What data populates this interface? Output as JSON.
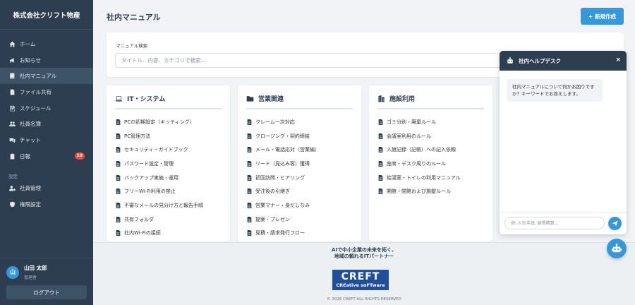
{
  "sidebar": {
    "brand": "株式会社クリフト物産",
    "items": [
      {
        "label": "ホーム",
        "icon": "home-icon"
      },
      {
        "label": "お知らせ",
        "icon": "megaphone-icon"
      },
      {
        "label": "社内マニュアル",
        "icon": "book-icon",
        "active": true
      },
      {
        "label": "ファイル共有",
        "icon": "file-icon"
      },
      {
        "label": "スケジュール",
        "icon": "calendar-icon"
      },
      {
        "label": "社員名簿",
        "icon": "users-icon"
      },
      {
        "label": "チャット",
        "icon": "chat-icon"
      },
      {
        "label": "日報",
        "icon": "clipboard-icon",
        "badge": "10"
      }
    ],
    "settings_label": "設定",
    "settings_items": [
      {
        "label": "社員管理",
        "icon": "user-gear-icon"
      },
      {
        "label": "権限設定",
        "icon": "shield-icon"
      }
    ],
    "user": {
      "avatar": "山",
      "name": "山田 太郎",
      "role": "管理者"
    },
    "logout": "ログアウト"
  },
  "header": {
    "title": "社内マニュアル",
    "new_button": "+ 新規作成"
  },
  "search": {
    "label": "マニュアル検索",
    "placeholder": "タイトル、内容、カテゴリで検索..."
  },
  "categories": [
    {
      "title": "IT・システム",
      "icon": "laptop-icon",
      "items": [
        "PCの初期設定（キッティング）",
        "PC管理方法",
        "セキュリティ・ガイドブック",
        "パスワード設定・管理",
        "バックアップ実施・運用",
        "フリーWi-Fi利用の禁止",
        "不審なメールの見分け方と報告手順",
        "共有フォルダ",
        "社内Wi-Fiの接続"
      ]
    },
    {
      "title": "営業関連",
      "icon": "folder-icon",
      "items": [
        "クレーム一次対応",
        "クロージング・契約締結",
        "メール・電話応対（営業編）",
        "リード（見込み客）獲得",
        "初回訪問・ヒアリング",
        "受注後の引継ぎ",
        "営業マナー・身だしなみ",
        "提案・プレゼン",
        "見積・請求発行フロー"
      ]
    },
    {
      "title": "施設利用",
      "icon": "building-icon",
      "items": [
        "ゴミ分別・廃棄ルール",
        "会議室利用のルール",
        "入館記録（記帳）への記入依頼",
        "座席・デスク周りのルール",
        "給湯室・トイレの利用マニュアル",
        "開館・閉館および施錠ルール"
      ]
    }
  ],
  "footer": {
    "tagline_1": "AIで中小企業の未来を拓く、",
    "tagline_2": "地域の頼れるITパートナー",
    "logo_main": "CREFT",
    "logo_sub": "CREative soFTware",
    "copyright": "© 2026 CREFT ALL RIGHTS RESERVED"
  },
  "chat": {
    "title": "社内ヘルプデスク",
    "close": "×",
    "message": "社内マニュアルについて何かお困りですか？キーワードでお答えします。",
    "placeholder": "例: 入社手続, 経費精算..."
  },
  "colors": {
    "sidebar_bg": "#2c3e50",
    "accent": "#3498db",
    "badge": "#e74c3c",
    "logo_bg": "#1f4e9a"
  }
}
